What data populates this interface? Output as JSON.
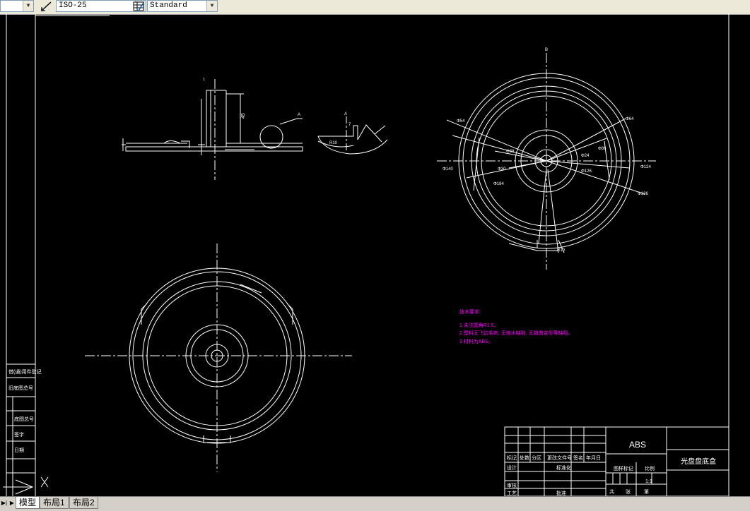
{
  "toolbar": {
    "layer_combo_value": "",
    "dimstyle_value": "ISO-25",
    "tablestyle_value": "Standard"
  },
  "annotations": {
    "view_label_a": "A",
    "detail_label_a": "A",
    "top_label_b": "B",
    "tech_title": "技术要求:",
    "tech_note_1": "1.未注圆角R1.5。",
    "tech_note_2": "2.塑料无飞边毛刺, 无缩水缺陷, 无翘曲变形等缺陷。",
    "tech_note_3": "3.材料为ABS。"
  },
  "dimensions": {
    "h45": "45",
    "h7": "7",
    "d54": "Φ54",
    "d64": "Φ64",
    "d140": "Φ140",
    "d124": "Φ124",
    "d184": "Φ184",
    "d30": "Φ30",
    "d38": "Φ38",
    "d24": "Φ24",
    "d136": "Φ136",
    "d126": "Φ126",
    "d86": "Φ86",
    "r10": "R10"
  },
  "left_panel": {
    "labels": [
      "借(通)用件登记",
      "旧底图总号",
      "底图总号",
      "签字",
      "日期"
    ]
  },
  "title_block": {
    "material": "ABS",
    "part_name": "光盘盘底盒",
    "scale_label": "比例",
    "scale_value": "1:1",
    "stage_label": "图样标记",
    "weight_label": "重量",
    "sheet_total": "共",
    "sheet_label": "张",
    "sheet_no": "第",
    "header_cells": [
      "标记",
      "处数",
      "分区",
      "更改文件号",
      "签名",
      "年月日"
    ],
    "roles": [
      "设计",
      "审核",
      "工艺"
    ],
    "std_label": "标准化",
    "approve_label": "批准"
  },
  "tabs": [
    {
      "label": "模型",
      "active": true
    },
    {
      "label": "布局1",
      "active": false
    },
    {
      "label": "布局2",
      "active": false
    }
  ],
  "colors": {
    "background": "#000000",
    "lines": "#ffffff",
    "notes": "#ff00ff",
    "ui_gray": "#ece9d8"
  }
}
